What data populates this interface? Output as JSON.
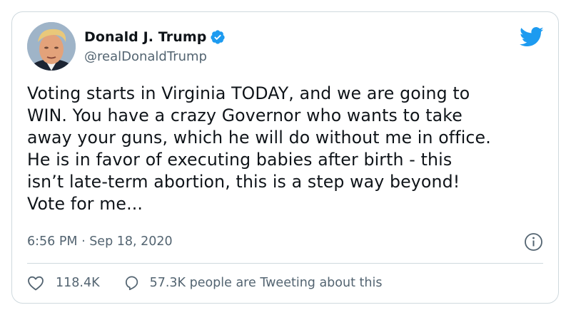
{
  "author": {
    "name": "Donald J. Trump",
    "handle": "@realDonaldTrump",
    "verified": true
  },
  "tweet": {
    "text": "Voting starts in Virginia TODAY, and we are going to\nWIN. You have a crazy Governor who wants to take\naway your guns, which he will do without me in office.\nHe is in favor of executing babies after birth - this\nisn’t late-term abortion, this is a step way beyond!\nVote for me...",
    "timestamp": "6:56 PM · Sep 18, 2020"
  },
  "engagement": {
    "likes": "118.4K",
    "conversation": "57.3K people are Tweeting about this"
  },
  "icons": {
    "brand": "twitter-bird-icon",
    "verified": "verified-badge-icon",
    "info": "info-icon",
    "like": "heart-icon",
    "reply": "speech-bubble-icon"
  },
  "colors": {
    "brand_blue": "#1d9bf0",
    "text_primary": "#0f1419",
    "text_secondary": "#536471",
    "border": "#cfd9de"
  }
}
